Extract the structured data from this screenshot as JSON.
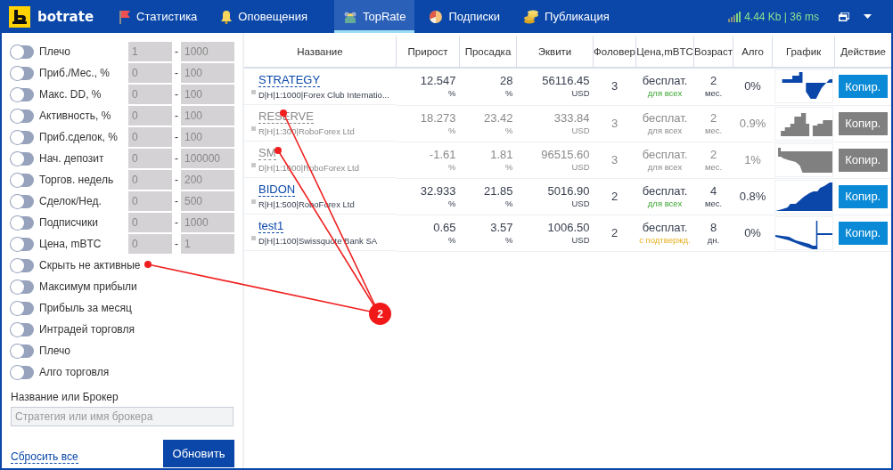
{
  "nav": {
    "logo": "botrate",
    "tabs": [
      {
        "label": "Статистика",
        "selected": false
      },
      {
        "label": "Оповещения",
        "selected": false
      },
      {
        "label": "TopRate",
        "selected": true
      },
      {
        "label": "Подписки",
        "selected": false
      },
      {
        "label": "Публикация",
        "selected": false
      }
    ],
    "connection": "4.44 Kb | 36 ms"
  },
  "filters": {
    "ranges": [
      {
        "label": "Плечо",
        "on": false,
        "min": "1",
        "dash": "-",
        "max": "1000"
      },
      {
        "label": "Приб./Мес., %",
        "on": false,
        "min": "0",
        "dash": "-",
        "max": "100"
      },
      {
        "label": "Макс. DD, %",
        "on": false,
        "min": "0",
        "dash": "-",
        "max": "100"
      },
      {
        "label": "Активность, %",
        "on": false,
        "min": "0",
        "dash": "-",
        "max": "100"
      },
      {
        "label": "Приб.сделок, %",
        "on": false,
        "min": "0",
        "dash": "-",
        "max": "100"
      },
      {
        "label": "Нач. депозит",
        "on": false,
        "min": "0",
        "dash": "-",
        "max": "100000"
      },
      {
        "label": "Торгов. недель",
        "on": false,
        "min": "0",
        "dash": "-",
        "max": "200"
      },
      {
        "label": "Сделок/Нед.",
        "on": false,
        "min": "0",
        "dash": "-",
        "max": "500"
      },
      {
        "label": "Подписчики",
        "on": false,
        "min": "0",
        "dash": "-",
        "max": "1000"
      },
      {
        "label": "Цена, mBTC",
        "on": false,
        "min": "0",
        "dash": "-",
        "max": "1"
      }
    ],
    "switches": [
      {
        "label": "Скрыть не активные",
        "on": false
      },
      {
        "label": "Максимум прибыли",
        "on": false
      },
      {
        "label": "Прибыль за месяц",
        "on": false
      },
      {
        "label": "Интрадей торговля",
        "on": false
      },
      {
        "label": "Плечо",
        "on": false
      },
      {
        "label": "Алго торговля",
        "on": false
      }
    ],
    "search": {
      "label": "Название или Брокер",
      "placeholder": "Стратегия или имя брокера"
    },
    "reset_link": "Сбросить все",
    "update_button": "Обновить"
  },
  "table": {
    "columns": [
      "Название",
      "Прирост",
      "Просадка",
      "Эквити",
      "Фоловер",
      "Цена,mBTC",
      "Возраст",
      "Алго",
      "График",
      "Действие"
    ],
    "rows": [
      {
        "name": "STRATEGY",
        "details": "D|H|1:1000|Forex Club Internatio...",
        "active": true,
        "growth": "12.547",
        "growth_unit": "%",
        "drawdown": "28",
        "drawdown_unit": "%",
        "equity": "56116.45",
        "currency": "USD",
        "followers": "3",
        "price": "бесплат.",
        "price_note": {
          "text": "для всех",
          "kind": "open"
        },
        "age": "2",
        "age_unit": "мес.",
        "algo": "0%",
        "action": "Копир."
      },
      {
        "name": "RESERVE",
        "details": "R|H|1:300|RoboForex Ltd",
        "active": false,
        "growth": "18.273",
        "growth_unit": "%",
        "drawdown": "23.42",
        "drawdown_unit": "%",
        "equity": "333.84",
        "currency": "USD",
        "followers": "3",
        "price": "бесплат.",
        "price_note": {
          "text": "для всех",
          "kind": "open"
        },
        "age": "2",
        "age_unit": "мес.",
        "algo": "0.9%",
        "action": "Копир."
      },
      {
        "name": "SM",
        "details": "D|H|1:1000|RoboForex Ltd",
        "active": false,
        "growth": "-1.61",
        "growth_unit": "%",
        "drawdown": "1.81",
        "drawdown_unit": "%",
        "equity": "96515.60",
        "currency": "USD",
        "followers": "3",
        "price": "бесплат.",
        "price_note": {
          "text": "для всех",
          "kind": "open"
        },
        "age": "2",
        "age_unit": "мес.",
        "algo": "1%",
        "action": "Копир."
      },
      {
        "name": "BIDON",
        "details": "R|H|1:500|RoboForex Ltd",
        "active": true,
        "growth": "32.933",
        "growth_unit": "%",
        "drawdown": "21.85",
        "drawdown_unit": "%",
        "equity": "5016.90",
        "currency": "USD",
        "followers": "2",
        "price": "бесплат.",
        "price_note": {
          "text": "для всех",
          "kind": "open"
        },
        "age": "4",
        "age_unit": "мес.",
        "algo": "0.8%",
        "action": "Копир."
      },
      {
        "name": "test1",
        "details": "D|H|1:100|Swissquote Bank SA",
        "active": true,
        "growth": "0.65",
        "growth_unit": "%",
        "drawdown": "3.57",
        "drawdown_unit": "%",
        "equity": "1006.50",
        "currency": "USD",
        "followers": "2",
        "price": "бесплат.",
        "price_note": {
          "text": "с подтвержд.",
          "kind": "confirm"
        },
        "age": "8",
        "age_unit": "дн.",
        "algo": "0%",
        "action": "Копир."
      }
    ]
  },
  "callout": {
    "label": "2"
  }
}
